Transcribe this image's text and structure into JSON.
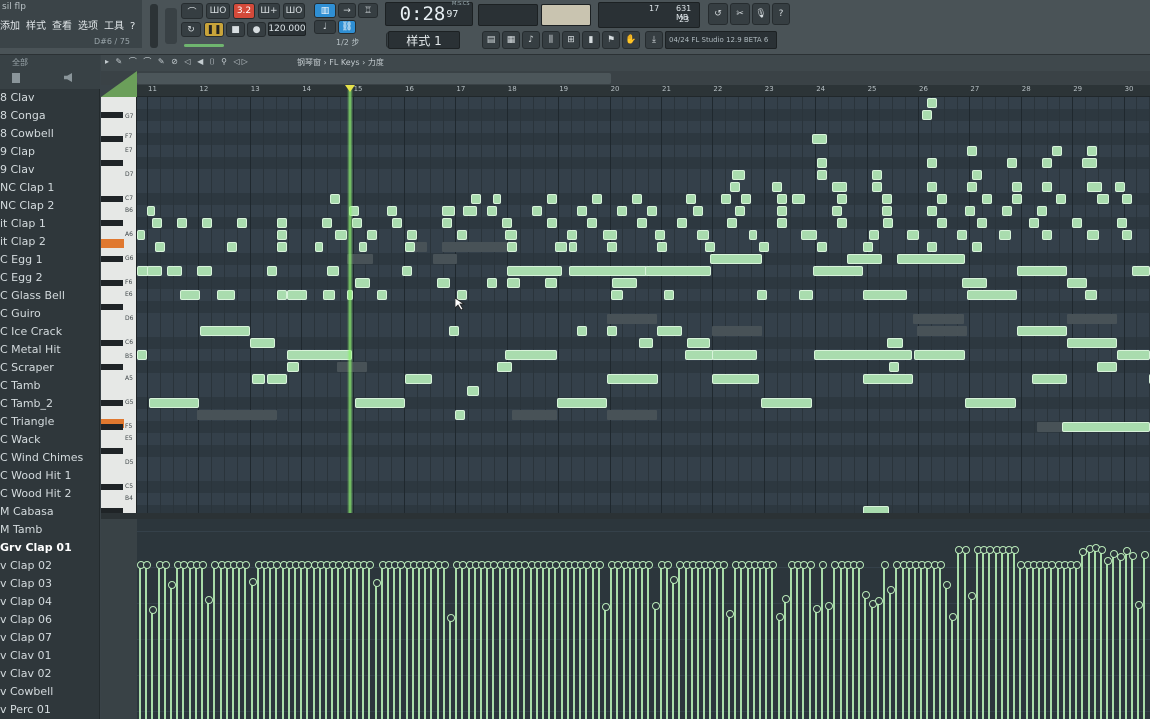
{
  "toolbar": {
    "project_file": "sil flp",
    "menus": [
      "添加",
      "样式",
      "查看",
      "选项",
      "工具",
      "?"
    ],
    "pattern_position": "D#6 / 75",
    "transport": {
      "record_mode": "3.2",
      "tempo": "120.000"
    },
    "time_display": {
      "main": "0:28",
      "sub": "97",
      "unit_label": "M:S:CS"
    },
    "cpu_memory": {
      "cpu": "17",
      "memory": "631 MB",
      "polyphony": "23"
    },
    "pattern_selector": "样式 1",
    "snap": "1/2 步",
    "hint_bar": "04/24 FL Studio 12.9 BETA 6",
    "accent_color": "#2f8fd4",
    "record_color": "#d44a3a"
  },
  "browser": {
    "header": "全部",
    "items": [
      "8 Clav",
      "8 Conga",
      "8 Cowbell",
      "9 Clap",
      "9 Clav",
      "NC Clap 1",
      "NC Clap 2",
      "it Clap 1",
      "it Clap 2",
      "C Egg 1",
      "C Egg 2",
      "C Glass Bell",
      "C Guiro",
      "C Ice Crack",
      "C Metal Hit",
      "C Scraper",
      "C Tamb",
      "C Tamb_2",
      "C Triangle",
      "C Wack",
      "C Wind Chimes",
      "C Wood Hit 1",
      "C Wood Hit 2",
      "M Cabasa",
      "M Tamb",
      "Grv Clap 01",
      "v Clap 02",
      "v Clap 03",
      "v Clap 04",
      "v Clap 06",
      "v Clap 07",
      "v Clav 01",
      "v Clav 02",
      "v Cowbell",
      "v Perc 01"
    ],
    "selected_index": 25
  },
  "piano_roll": {
    "breadcrumb": "钢琴窗 › FL Keys › 力度",
    "bars": [
      "11",
      "12",
      "13",
      "14",
      "15",
      "16",
      "17",
      "18",
      "19",
      "20",
      "21",
      "22",
      "23",
      "24",
      "25",
      "26",
      "27",
      "28",
      "29",
      "30"
    ],
    "key_labels": [
      "G7",
      "F7",
      "E7",
      "D7",
      "C7",
      "B6",
      "A6",
      "G6",
      "F6",
      "E6",
      "D6",
      "C6",
      "B5",
      "A5",
      "G5",
      "F5",
      "E5",
      "D5",
      "C5",
      "B4"
    ],
    "note_color": "#a9dcae",
    "playhead_color": "#8cf06e"
  }
}
